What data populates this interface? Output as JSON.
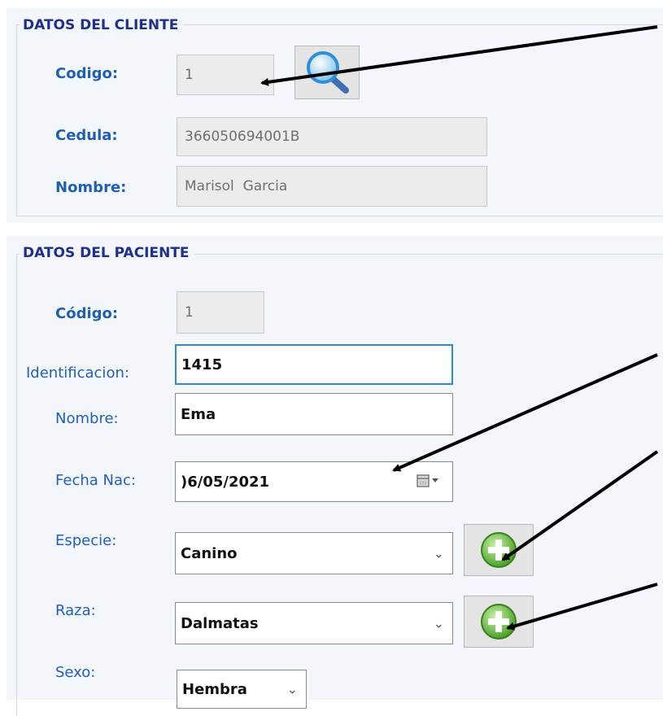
{
  "client_section": {
    "legend": "DATOS DEL CLIENTE",
    "codigo_label": "Codigo:",
    "codigo_value": "1",
    "search_icon": "magnifier-icon",
    "cedula_label": "Cedula:",
    "cedula_value": "366050694001B",
    "nombre_label": "Nombre:",
    "nombre_value": "Marisol  Garcia"
  },
  "patient_section": {
    "legend": "DATOS DEL PACIENTE",
    "codigo_label": "Código:",
    "codigo_value": "1",
    "identificacion_label": "Identificacion:",
    "identificacion_value": "1415",
    "nombre_label": "Nombre:",
    "nombre_value": "Ema",
    "fecha_label": "Fecha Nac:",
    "fecha_value": ")6/05/2021",
    "calendar_icon": "calendar-dropdown-icon",
    "especie_label": "Especie:",
    "especie_value": "Canino",
    "add_icon": "green-plus-icon",
    "raza_label": "Raza:",
    "raza_value": "Dalmatas",
    "sexo_label": "Sexo:",
    "sexo_value": "Hembra",
    "chevron": "⌄"
  },
  "colors": {
    "legend": "#1e2f8c",
    "label": "#1f5fb0",
    "panel_bg": "#f3f7fb",
    "focus_border": "#2b87d8",
    "add_green": "#5fbf3a"
  }
}
